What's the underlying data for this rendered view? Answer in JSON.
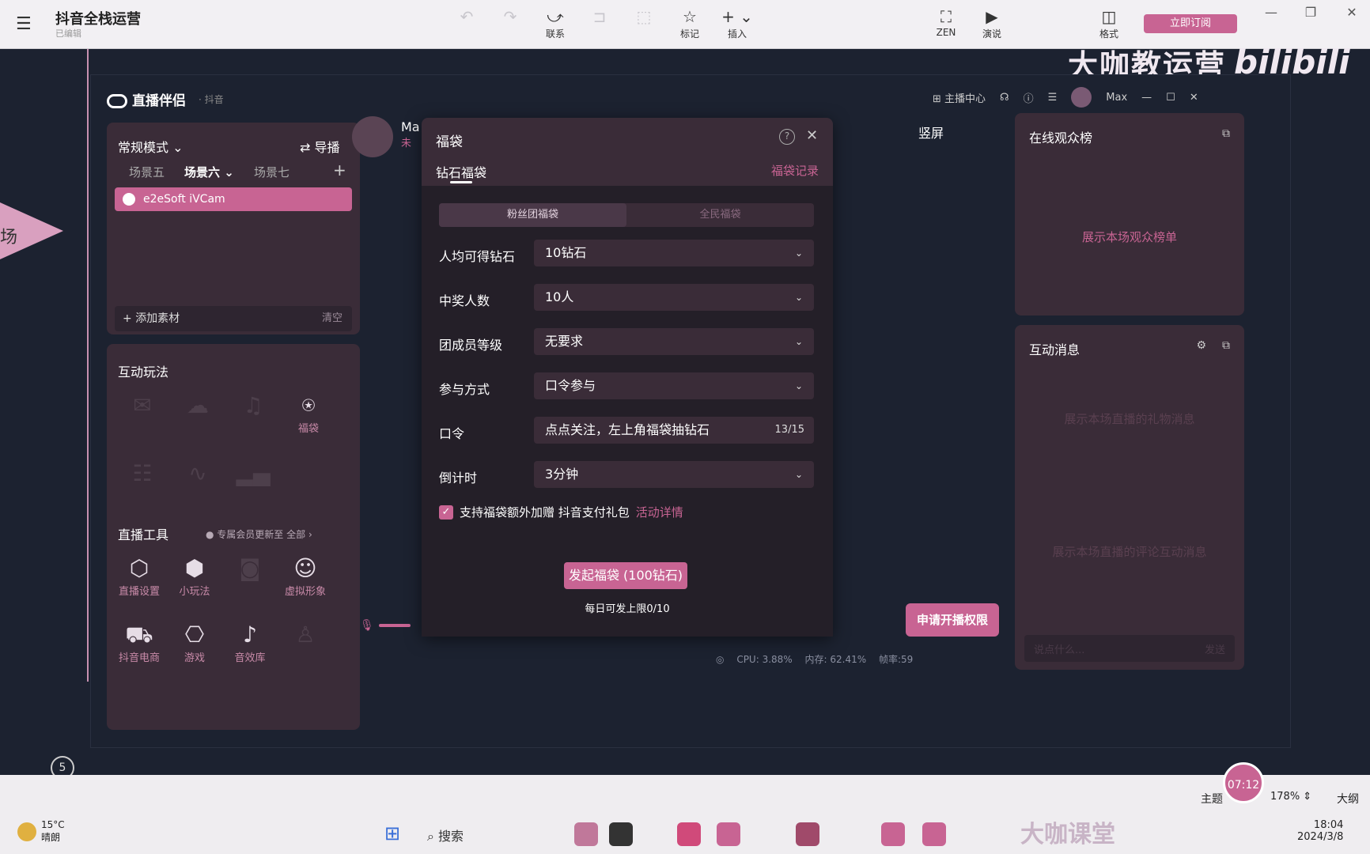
{
  "topbar": {
    "title": "抖音全栈运营",
    "subtitle": "已编辑",
    "buttons": [
      {
        "label": "",
        "icon": "undo-icon"
      },
      {
        "label": "",
        "icon": "redo-icon"
      },
      {
        "label": "联系",
        "icon": "relation-icon"
      },
      {
        "label": "",
        "icon": "summary-icon"
      },
      {
        "label": "",
        "icon": "boundary-icon"
      },
      {
        "label": "标记",
        "icon": "star-icon"
      },
      {
        "label": "插入",
        "icon": "plus-icon"
      },
      {
        "label": "ZEN",
        "icon": "zen-icon"
      },
      {
        "label": "演说",
        "icon": "pitch-icon"
      },
      {
        "label": "格式",
        "icon": "format-icon"
      }
    ],
    "subscribe": "立即订阅"
  },
  "watermark": "大咖教运营",
  "bili": "bilibili",
  "left_node": "场",
  "node_number": "5",
  "app": {
    "title": "直播伴侣",
    "subtitle": "· 抖音",
    "anchor_center": "主播中心",
    "user": "Max",
    "mode": "常规模式",
    "guide": "导播",
    "scenes": [
      "场景五",
      "场景六",
      "场景七"
    ],
    "source": "e2eSoft iVCam",
    "add_material": "添加素材",
    "clear": "清空",
    "interact_title": "互动玩法",
    "fudai_tool": "福袋",
    "live_tools_title": "直播工具",
    "update_note": "专属会员更新至",
    "all": "全部",
    "tools": [
      "直播设置",
      "小玩法",
      "",
      "虚拟形象",
      "抖音电商",
      "游戏",
      "音效库",
      ""
    ],
    "broadcaster": "Ma",
    "broadcaster_tag": "未",
    "vertical": "竖屏",
    "audience_title": "在线观众榜",
    "audience_empty": "展示本场观众榜单",
    "messages_title": "互动消息",
    "gift_empty": "展示本场直播的礼物消息",
    "comment_empty": "展示本场直播的评论互动消息",
    "say_placeholder": "说点什么...",
    "send": "发送",
    "apply": "申请开播权限",
    "cpu": "CPU: 3.88%",
    "mem": "内存: 62.41%",
    "fps": "帧率:59"
  },
  "modal": {
    "title": "福袋",
    "tab": "钻石福袋",
    "record": "福袋记录",
    "seg1": "粉丝团福袋",
    "seg2": "全民福袋",
    "rows": [
      {
        "label": "人均可得钻石",
        "value": "10钻石"
      },
      {
        "label": "中奖人数",
        "value": "10人"
      },
      {
        "label": "团成员等级",
        "value": "无要求"
      },
      {
        "label": "参与方式",
        "value": "口令参与"
      },
      {
        "label": "口令",
        "value": "点点关注，左上角福袋抽钻石",
        "count": "13/15"
      },
      {
        "label": "倒计时",
        "value": "3分钟"
      }
    ],
    "checkbox_text": "支持福袋额外加赠 抖音支付礼包",
    "checkbox_link": "活动详情",
    "launch": "发起福袋 (100钻石)",
    "limit": "每日可发上限0/10"
  },
  "taskbar": {
    "temp": "15°C",
    "weather": "晴朗",
    "search": "搜索",
    "time": "18:04",
    "date": "2024/3/8",
    "timer": "07:12",
    "zoom": "178%",
    "outline": "大纲",
    "theme": "主题",
    "classroom": "大咖课堂"
  }
}
